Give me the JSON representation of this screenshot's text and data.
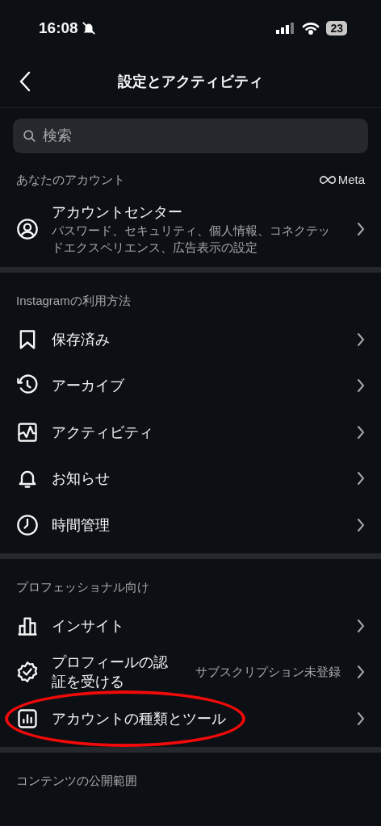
{
  "status_bar": {
    "time": "16:08",
    "battery": "23"
  },
  "header": {
    "title": "設定とアクティビティ"
  },
  "search": {
    "placeholder": "検索"
  },
  "sections": [
    {
      "title": "あなたのアカウント",
      "brand": "Meta",
      "items": [
        {
          "label": "アカウントセンター",
          "subtitle": "パスワード、セキュリティ、個人情報、コネクテッドエクスペリエンス、広告表示の設定",
          "circled": false
        }
      ]
    },
    {
      "title": "Instagramの利用方法",
      "items": [
        {
          "label": "保存済み",
          "circled": false
        },
        {
          "label": "アーカイブ",
          "circled": false
        },
        {
          "label": "アクティビティ",
          "circled": false
        },
        {
          "label": "お知らせ",
          "circled": false
        },
        {
          "label": "時間管理",
          "circled": false
        }
      ]
    },
    {
      "title": "プロフェッショナル向け",
      "items": [
        {
          "label": "インサイト",
          "circled": false
        },
        {
          "label": "プロフィールの認証を受ける",
          "value": "サブスクリプション未登録",
          "circled": false
        },
        {
          "label": "アカウントの種類とツール",
          "circled": true
        }
      ]
    },
    {
      "title": "コンテンツの公開範囲"
    }
  ]
}
